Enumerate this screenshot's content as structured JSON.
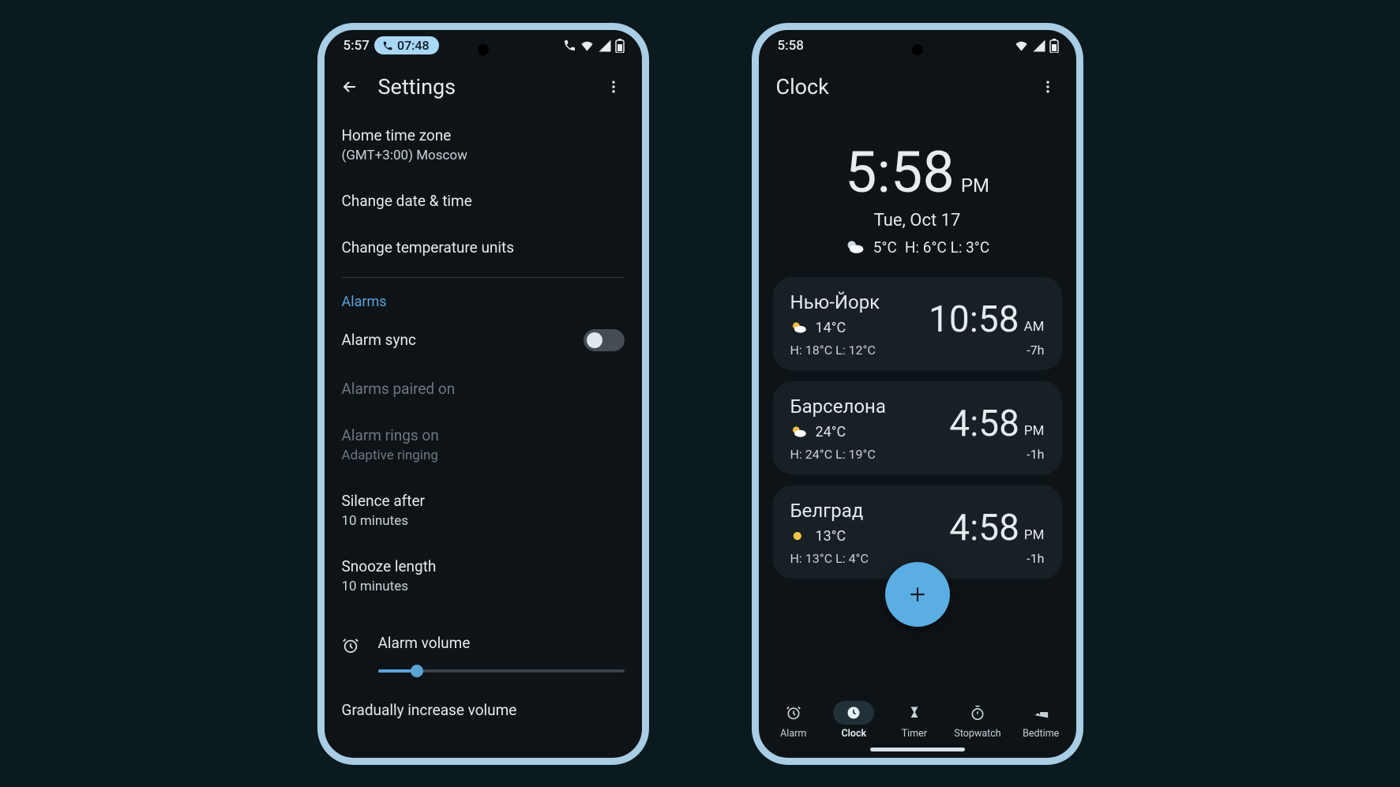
{
  "phone1": {
    "status": {
      "time": "5:57",
      "pill_time": "07:48"
    },
    "topbar": {
      "title": "Settings"
    },
    "items": {
      "home_tz_title": "Home time zone",
      "home_tz_sub": "(GMT+3:00) Moscow",
      "change_dt": "Change date & time",
      "change_temp": "Change temperature units",
      "alarms_header": "Alarms",
      "alarm_sync": "Alarm sync",
      "paired_on": "Alarms paired on",
      "rings_on_title": "Alarm rings on",
      "rings_on_sub": "Adaptive ringing",
      "silence_title": "Silence after",
      "silence_sub": "10 minutes",
      "snooze_title": "Snooze length",
      "snooze_sub": "10 minutes",
      "volume_label": "Alarm volume",
      "grad_label": "Gradually increase volume"
    }
  },
  "phone2": {
    "status": {
      "time": "5:58"
    },
    "topbar": {
      "title": "Clock"
    },
    "main": {
      "time": "5:58",
      "ampm": "PM",
      "date": "Tue, Oct 17",
      "temp": "5°C",
      "hl": "H: 6°C L: 3°C"
    },
    "cities": [
      {
        "name": "Нью-Йорк",
        "temp": "14°C",
        "hl": "H: 18°C L: 12°C",
        "time": "10:58",
        "ampm": "AM",
        "offset": "-7h"
      },
      {
        "name": "Барселона",
        "temp": "24°C",
        "hl": "H: 24°C L: 19°C",
        "time": "4:58",
        "ampm": "PM",
        "offset": "-1h"
      },
      {
        "name": "Белград",
        "temp": "13°C",
        "hl": "H: 13°C L: 4°C",
        "time": "4:58",
        "ampm": "PM",
        "offset": "-1h"
      }
    ],
    "nav": {
      "alarm": "Alarm",
      "clock": "Clock",
      "timer": "Timer",
      "stopwatch": "Stopwatch",
      "bedtime": "Bedtime"
    }
  }
}
